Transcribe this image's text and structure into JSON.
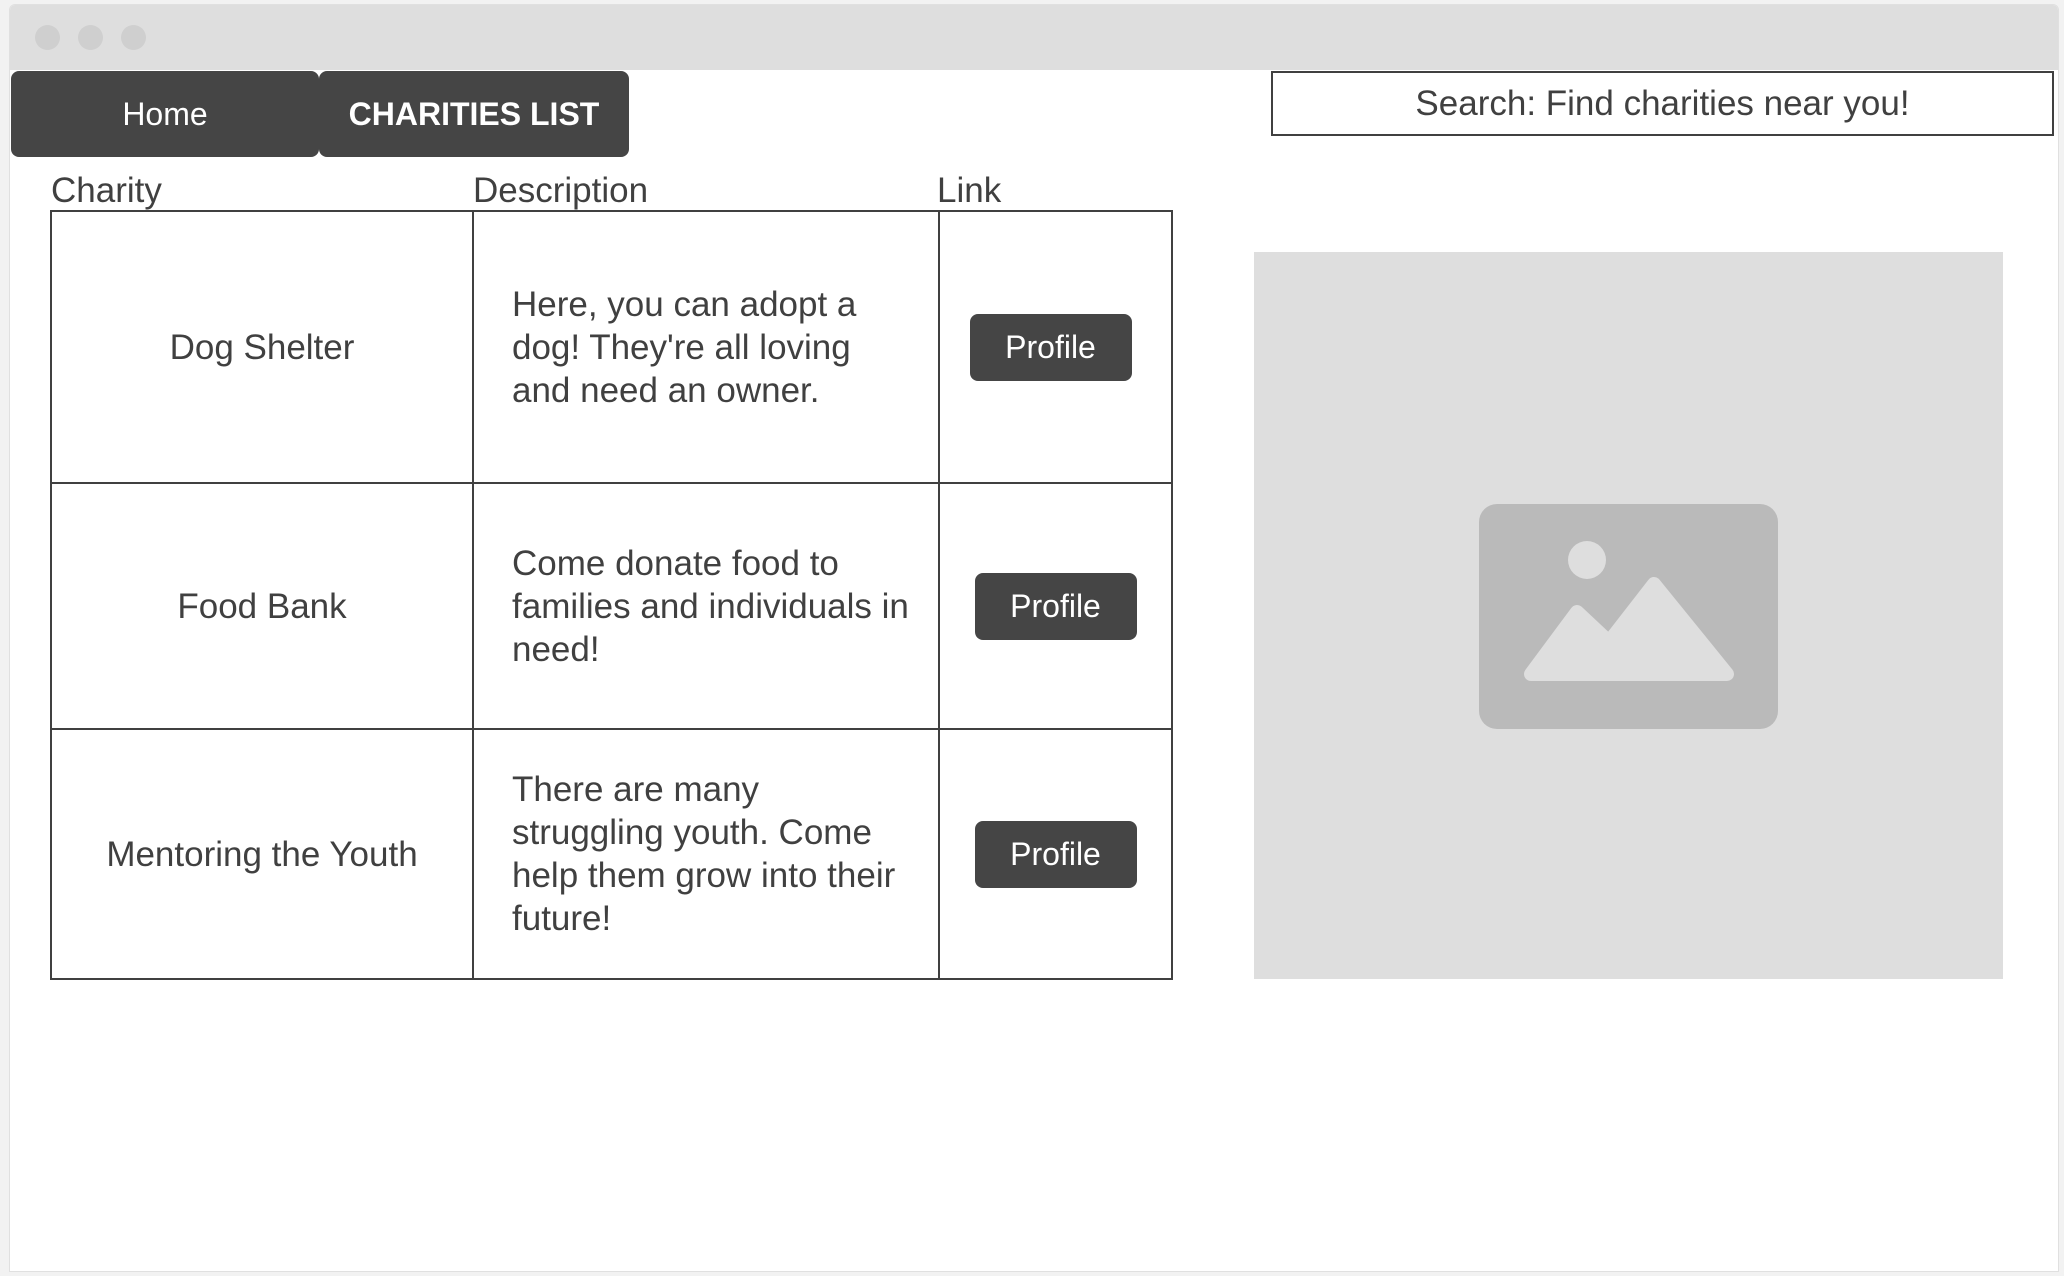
{
  "nav": {
    "home_label": "Home",
    "charities_label": "CHARITIES LIST"
  },
  "search": {
    "text": "Search: Find charities near you!"
  },
  "table": {
    "headers": {
      "charity": "Charity",
      "description": "Description",
      "link": "Link"
    },
    "rows": [
      {
        "charity": "Dog Shelter",
        "description": "Here, you can adopt a dog! They're all loving and need an owner.",
        "button": "Profile"
      },
      {
        "charity": "Food Bank",
        "description": "Come donate food to families and individuals in need!",
        "button": "Profile"
      },
      {
        "charity": "Mentoring the Youth",
        "description": "There are many struggling youth. Come help them grow into their future!",
        "button": "Profile"
      }
    ]
  },
  "image_placeholder": {
    "icon": "image-icon"
  },
  "colors": {
    "button_bg": "#454545",
    "button_text": "#ffffff",
    "text": "#404040",
    "titlebar": "#dedede",
    "placeholder_bg": "#dedede",
    "placeholder_icon": "#bababa"
  }
}
